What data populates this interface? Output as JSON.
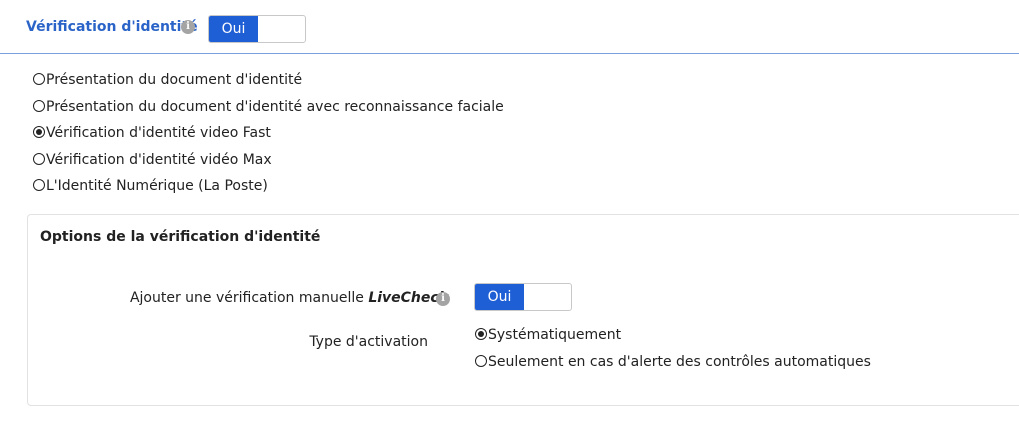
{
  "header": {
    "title": "Vérification d'identité",
    "info_glyph": "i",
    "toggle_on_label": "Oui"
  },
  "methods": [
    {
      "label": "Présentation du document d'identité",
      "checked": false
    },
    {
      "label": "Présentation du document d'identité avec reconnaissance faciale",
      "checked": false
    },
    {
      "label": "Vérification d'identité video Fast",
      "checked": true
    },
    {
      "label": "Vérification d'identité vidéo Max",
      "checked": false
    },
    {
      "label": "L'Identité Numérique (La Poste)",
      "checked": false
    }
  ],
  "options": {
    "title": "Options de la vérification d'identité",
    "livecheck": {
      "label_prefix": "Ajouter une vérification manuelle ",
      "label_emphasis": "LiveCheck",
      "info_glyph": "i",
      "toggle_on_label": "Oui"
    },
    "activation": {
      "label": "Type d'activation",
      "choices": [
        {
          "label": "Systématiquement",
          "checked": true
        },
        {
          "label": "Seulement en cas d'alerte des contrôles automatiques",
          "checked": false
        }
      ]
    }
  },
  "colors": {
    "accent": "#1f5fd6",
    "title_blue": "#2b64c8",
    "divider": "#7aa1da",
    "info_icon": "#a4a4a4"
  },
  "icons": {
    "info": "info-icon",
    "radio": "radio-icon"
  }
}
